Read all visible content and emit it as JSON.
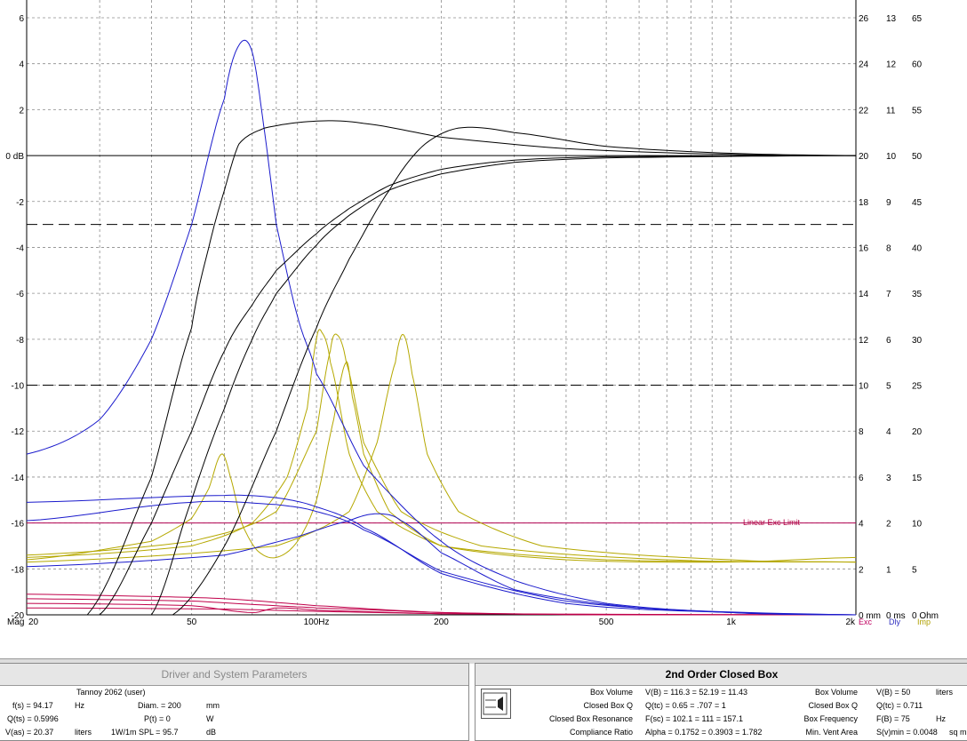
{
  "chart_data": {
    "type": "line",
    "x_scale": "log",
    "xlim": [
      20,
      2000
    ],
    "ylim_left": [
      -20,
      6
    ],
    "ylabel_left": "Mag",
    "x_ticks": [
      "20",
      "50",
      "100Hz",
      "200",
      "500",
      "1k",
      "2k"
    ],
    "x_tick_values": [
      20,
      50,
      100,
      200,
      500,
      1000,
      2000
    ],
    "left_ticks": [
      "6",
      "4",
      "2",
      "0 dB",
      "-2",
      "-4",
      "-6",
      "-8",
      "-10",
      "-12",
      "-14",
      "-16",
      "-18",
      "-20"
    ],
    "right_ticks_exc": [
      "26",
      "24",
      "22",
      "20",
      "18",
      "16",
      "14",
      "12",
      "10",
      "8",
      "6",
      "4",
      "2",
      "0 mm"
    ],
    "right_ticks_dly": [
      "13",
      "12",
      "11",
      "10",
      "9",
      "8",
      "7",
      "6",
      "5",
      "4",
      "3",
      "2",
      "1",
      "0 ms"
    ],
    "right_ticks_imp": [
      "65",
      "60",
      "55",
      "50",
      "45",
      "40",
      "35",
      "30",
      "25",
      "20",
      "15",
      "10",
      "5",
      "0 Ohm"
    ],
    "legend": {
      "exc": "Exc",
      "dly": "Dly",
      "imp": "Imp"
    },
    "annotation": "Linear Exc Limit",
    "reference_lines": [
      {
        "y": -3,
        "style": "dashed"
      },
      {
        "y": -10,
        "style": "dashed"
      }
    ],
    "colors": {
      "mag": "#000000",
      "exc": "#c0004a",
      "dly": "#1a1acc",
      "imp": "#b5a800",
      "limit": "#b00050"
    },
    "series": [
      {
        "group": "mag",
        "points": [
          [
            28,
            -20
          ],
          [
            40,
            -14
          ],
          [
            50,
            -7.5
          ],
          [
            55,
            -4
          ],
          [
            60,
            -1.5
          ],
          [
            65,
            0.5
          ],
          [
            75,
            1.2
          ],
          [
            100,
            1.5
          ],
          [
            130,
            1.4
          ],
          [
            200,
            0.8
          ],
          [
            400,
            0.3
          ],
          [
            1000,
            0.05
          ],
          [
            2000,
            0
          ]
        ]
      },
      {
        "group": "mag",
        "points": [
          [
            30,
            -20
          ],
          [
            40,
            -16
          ],
          [
            50,
            -12
          ],
          [
            60,
            -8.5
          ],
          [
            70,
            -6.5
          ],
          [
            80,
            -5
          ],
          [
            100,
            -3.4
          ],
          [
            120,
            -2.3
          ],
          [
            150,
            -1.3
          ],
          [
            200,
            -0.6
          ],
          [
            300,
            -0.2
          ],
          [
            500,
            -0.05
          ],
          [
            2000,
            0
          ]
        ]
      },
      {
        "group": "mag",
        "points": [
          [
            40,
            -20
          ],
          [
            50,
            -15
          ],
          [
            60,
            -11
          ],
          [
            70,
            -8
          ],
          [
            80,
            -6
          ],
          [
            100,
            -3.9
          ],
          [
            120,
            -2.6
          ],
          [
            150,
            -1.5
          ],
          [
            200,
            -0.8
          ],
          [
            300,
            -0.3
          ],
          [
            500,
            -0.1
          ],
          [
            2000,
            0
          ]
        ]
      },
      {
        "group": "mag",
        "points": [
          [
            45,
            -20
          ],
          [
            60,
            -17
          ],
          [
            80,
            -12
          ],
          [
            100,
            -7.5
          ],
          [
            120,
            -4.5
          ],
          [
            150,
            -1.5
          ],
          [
            180,
            0.4
          ],
          [
            220,
            1.2
          ],
          [
            300,
            1
          ],
          [
            500,
            0.4
          ],
          [
            1000,
            0.1
          ],
          [
            2000,
            0
          ]
        ]
      },
      {
        "group": "dly",
        "points": [
          [
            20,
            -13
          ],
          [
            30,
            -11.5
          ],
          [
            40,
            -8
          ],
          [
            50,
            -3
          ],
          [
            60,
            2.5
          ],
          [
            65,
            4.8
          ],
          [
            70,
            4.5
          ],
          [
            75,
            1
          ],
          [
            80,
            -3
          ],
          [
            90,
            -7
          ],
          [
            100,
            -9.5
          ],
          [
            130,
            -13.5
          ],
          [
            200,
            -16.8
          ],
          [
            300,
            -18.5
          ],
          [
            500,
            -19.5
          ],
          [
            1000,
            -19.9
          ],
          [
            2000,
            -20
          ]
        ]
      },
      {
        "group": "dly",
        "points": [
          [
            20,
            -15.1
          ],
          [
            60,
            -14.8
          ],
          [
            80,
            -14.9
          ],
          [
            100,
            -15.3
          ],
          [
            130,
            -16.2
          ],
          [
            200,
            -18.2
          ],
          [
            400,
            -19.5
          ],
          [
            1000,
            -19.9
          ],
          [
            2000,
            -20
          ]
        ]
      },
      {
        "group": "dly",
        "points": [
          [
            20,
            -15.9
          ],
          [
            50,
            -15.1
          ],
          [
            80,
            -15.2
          ],
          [
            100,
            -15.5
          ],
          [
            130,
            -16.3
          ],
          [
            200,
            -18.1
          ],
          [
            400,
            -19.4
          ],
          [
            1000,
            -19.9
          ],
          [
            2000,
            -20
          ]
        ]
      },
      {
        "group": "dly",
        "points": [
          [
            20,
            -17.9
          ],
          [
            60,
            -17.4
          ],
          [
            90,
            -16.6
          ],
          [
            120,
            -15.9
          ],
          [
            140,
            -15.6
          ],
          [
            160,
            -15.9
          ],
          [
            200,
            -17.3
          ],
          [
            300,
            -18.9
          ],
          [
            600,
            -19.7
          ],
          [
            2000,
            -20
          ]
        ]
      },
      {
        "group": "imp",
        "points": [
          [
            20,
            -17.6
          ],
          [
            40,
            -16.8
          ],
          [
            50,
            -15.8
          ],
          [
            55,
            -14.5
          ],
          [
            59,
            -13
          ],
          [
            62,
            -14
          ],
          [
            66,
            -16
          ],
          [
            72,
            -17.2
          ],
          [
            80,
            -17.5
          ],
          [
            90,
            -16.8
          ],
          [
            100,
            -15
          ],
          [
            110,
            -11.5
          ],
          [
            118,
            -9
          ],
          [
            122,
            -10.5
          ],
          [
            130,
            -13
          ],
          [
            150,
            -15.5
          ],
          [
            200,
            -17
          ],
          [
            400,
            -17.6
          ],
          [
            1000,
            -17.7
          ],
          [
            2000,
            -17.5
          ]
        ]
      },
      {
        "group": "imp",
        "points": [
          [
            20,
            -17.5
          ],
          [
            50,
            -17
          ],
          [
            70,
            -16
          ],
          [
            85,
            -14
          ],
          [
            95,
            -11
          ],
          [
            100,
            -8
          ],
          [
            103,
            -7.7
          ],
          [
            108,
            -9
          ],
          [
            120,
            -13
          ],
          [
            140,
            -15.5
          ],
          [
            200,
            -17
          ],
          [
            500,
            -17.6
          ],
          [
            2000,
            -17.7
          ]
        ]
      },
      {
        "group": "imp",
        "points": [
          [
            20,
            -17.4
          ],
          [
            50,
            -16.8
          ],
          [
            80,
            -15.5
          ],
          [
            100,
            -12
          ],
          [
            108,
            -8.5
          ],
          [
            112,
            -7.8
          ],
          [
            118,
            -9
          ],
          [
            130,
            -12.5
          ],
          [
            160,
            -15.5
          ],
          [
            250,
            -17
          ],
          [
            700,
            -17.6
          ],
          [
            2000,
            -17.7
          ]
        ]
      },
      {
        "group": "imp",
        "points": [
          [
            20,
            -17.7
          ],
          [
            80,
            -17
          ],
          [
            120,
            -15.5
          ],
          [
            140,
            -12.5
          ],
          [
            155,
            -9
          ],
          [
            162,
            -7.8
          ],
          [
            170,
            -9.5
          ],
          [
            185,
            -13
          ],
          [
            220,
            -15.5
          ],
          [
            350,
            -17
          ],
          [
            1000,
            -17.6
          ],
          [
            2000,
            -17.7
          ]
        ]
      },
      {
        "group": "exc",
        "points": [
          [
            20,
            -19.1
          ],
          [
            40,
            -19.2
          ],
          [
            60,
            -19.3
          ],
          [
            100,
            -19.6
          ],
          [
            200,
            -19.9
          ],
          [
            500,
            -20
          ],
          [
            2000,
            -20
          ]
        ]
      },
      {
        "group": "exc",
        "points": [
          [
            20,
            -19.3
          ],
          [
            50,
            -19.4
          ],
          [
            80,
            -19.6
          ],
          [
            100,
            -19.7
          ],
          [
            200,
            -19.9
          ],
          [
            500,
            -20
          ],
          [
            2000,
            -20
          ]
        ]
      },
      {
        "group": "exc",
        "points": [
          [
            20,
            -19.5
          ],
          [
            50,
            -19.6
          ],
          [
            70,
            -19.9
          ],
          [
            80,
            -19.7
          ],
          [
            100,
            -19.8
          ],
          [
            200,
            -19.95
          ],
          [
            2000,
            -20
          ]
        ]
      },
      {
        "group": "exc",
        "points": [
          [
            20,
            -19.7
          ],
          [
            60,
            -19.75
          ],
          [
            100,
            -19.85
          ],
          [
            200,
            -19.95
          ],
          [
            2000,
            -20
          ]
        ]
      }
    ]
  },
  "driver_panel": {
    "title": "Driver and System Parameters",
    "driver_name": "Tannoy 2062 (user)",
    "fs_label": "f(s) = 94.17",
    "fs_unit": "Hz",
    "qts_label": "Q(ts) = 0.5996",
    "vas_label": "V(as) = 20.37",
    "vas_unit": "liters",
    "diam_label": "Diam. = 200",
    "diam_unit": "mm",
    "pt_label": "P(t) = 0",
    "pt_unit": "W",
    "spl_label": "1W/1m SPL = 95.7",
    "spl_unit": "dB"
  },
  "box_panel": {
    "title": "2nd Order Closed Box",
    "rows": [
      {
        "label": "Box Volume",
        "value": "V(B) = 116.3   = 52.19   = 11.43",
        "label2": "Box Volume",
        "value2": "V(B) = 50",
        "unit2": "liters"
      },
      {
        "label": "Closed Box Q",
        "value": "Q(tc) = 0.65   = .707     = 1",
        "label2": "Closed Box Q",
        "value2": "Q(tc) = 0.711",
        "unit2": ""
      },
      {
        "label": "Closed Box Resonance",
        "value": "F(sc) = 102.1   = 111     = 157.1",
        "label2": "Box Frequency",
        "value2": "F(B) = 75",
        "unit2": "Hz"
      },
      {
        "label": "Compliance Ratio",
        "value": "Alpha = 0.1752  = 0.3903  = 1.782",
        "label2": "Min. Vent Area",
        "value2": "S(v)min = 0.0048",
        "unit2": "sq m"
      }
    ]
  }
}
